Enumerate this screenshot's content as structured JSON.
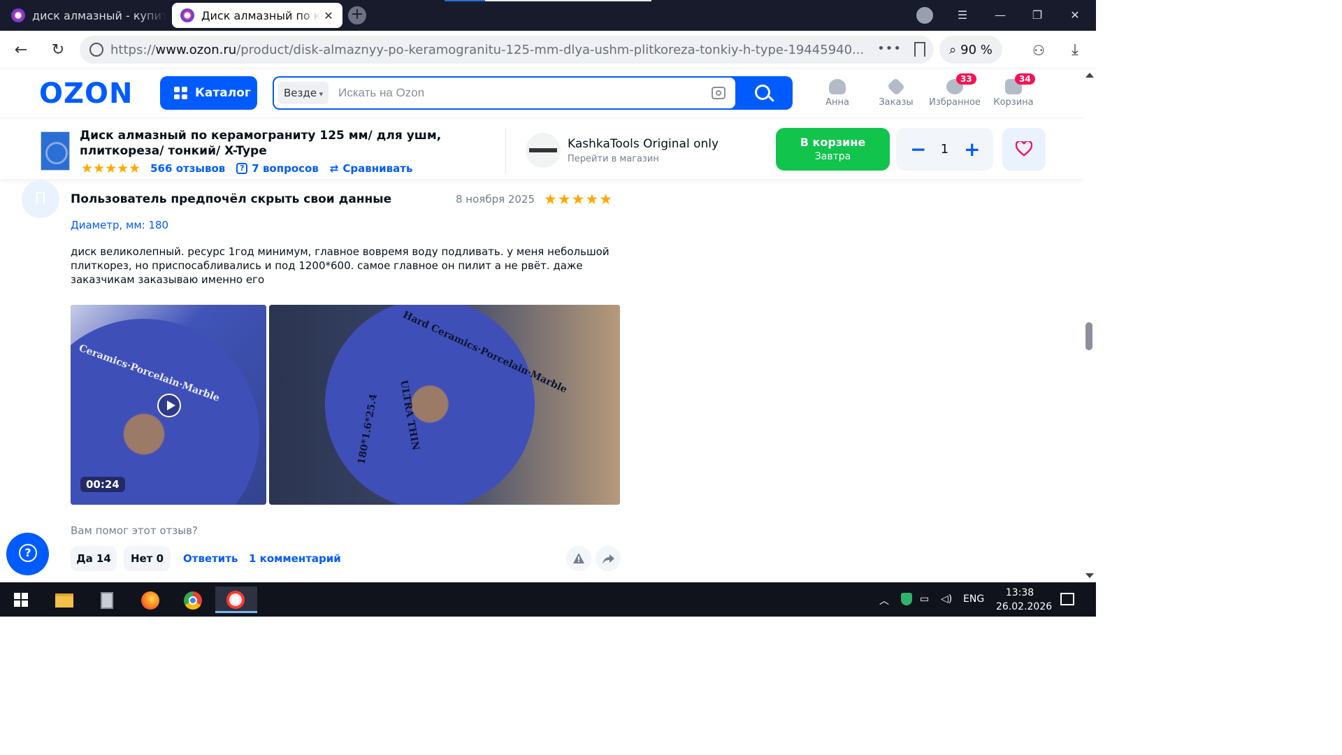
{
  "browser": {
    "tabs": [
      {
        "title": "диск алмазный - купить н",
        "active": false
      },
      {
        "title": "Диск алмазный по кер",
        "active": true
      }
    ],
    "url_prefix": "https://",
    "url_host": "www.ozon.ru",
    "url_path": "/product/disk-almaznyy-po-keramogranitu-125-mm-dlya-ushm-plitkoreza-tonkiy-h-type-19445940...",
    "zoom": "90 %"
  },
  "header": {
    "logo": "OZON",
    "catalog_label": "Каталог",
    "search_scope": "Везде",
    "search_placeholder": "Искать на Ozon",
    "user_label": "Анна",
    "orders_label": "Заказы",
    "favorites_label": "Избранное",
    "favorites_count": "33",
    "cart_label": "Корзина",
    "cart_count": "34"
  },
  "product_bar": {
    "title": "Диск алмазный по керамограниту 125 мм/ для ушм, плиткореза/ тонкий/ X-Type",
    "rating_stars": "★★★★★",
    "reviews_link": "566 отзывов",
    "questions_link": "7 вопросов",
    "compare_link": "Сравнивать",
    "shop_name": "KashkaTools Original only",
    "shop_sub": "Перейти в магазин",
    "cart_button_line1": "В корзине",
    "cart_button_line2": "Завтра",
    "quantity": "1",
    "minus": "−",
    "plus": "+"
  },
  "review": {
    "avatar_letter": "П",
    "author": "Пользователь предпочёл скрыть свои данные",
    "date": "8 ноября 2025",
    "stars": "★★★★★",
    "variant": "Диаметр, мм: 180",
    "text": "диск великолепный. ресурс 1год минимум, главное вовремя воду подливать. у меня небольшой плиткорез, но приспосабливались и под 1200*600. самое главное он пилит а не рвёт. даже заказчикам заказываю именно его",
    "video_duration": "00:24",
    "disc_text_1": "Ceramics·Porcelain·Marble",
    "disc_text_2": "Hard Ceramics·Porcelain·Marble",
    "disc_text_3": "ULTRA THIN",
    "disc_text_4": "180*1.6*25.4",
    "helpful_question": "Вам помог этот отзыв?",
    "yes_label": "Да 14",
    "no_label": "Нет 0",
    "reply_link": "Ответить",
    "comments_link": "1 комментарий"
  },
  "taskbar": {
    "lang": "ENG",
    "time": "13:38",
    "date": "26.02.2026"
  },
  "colors": {
    "ozon_blue": "#005bff",
    "cart_green": "#10c44c",
    "star": "#ffa800",
    "badge": "#f91155"
  }
}
